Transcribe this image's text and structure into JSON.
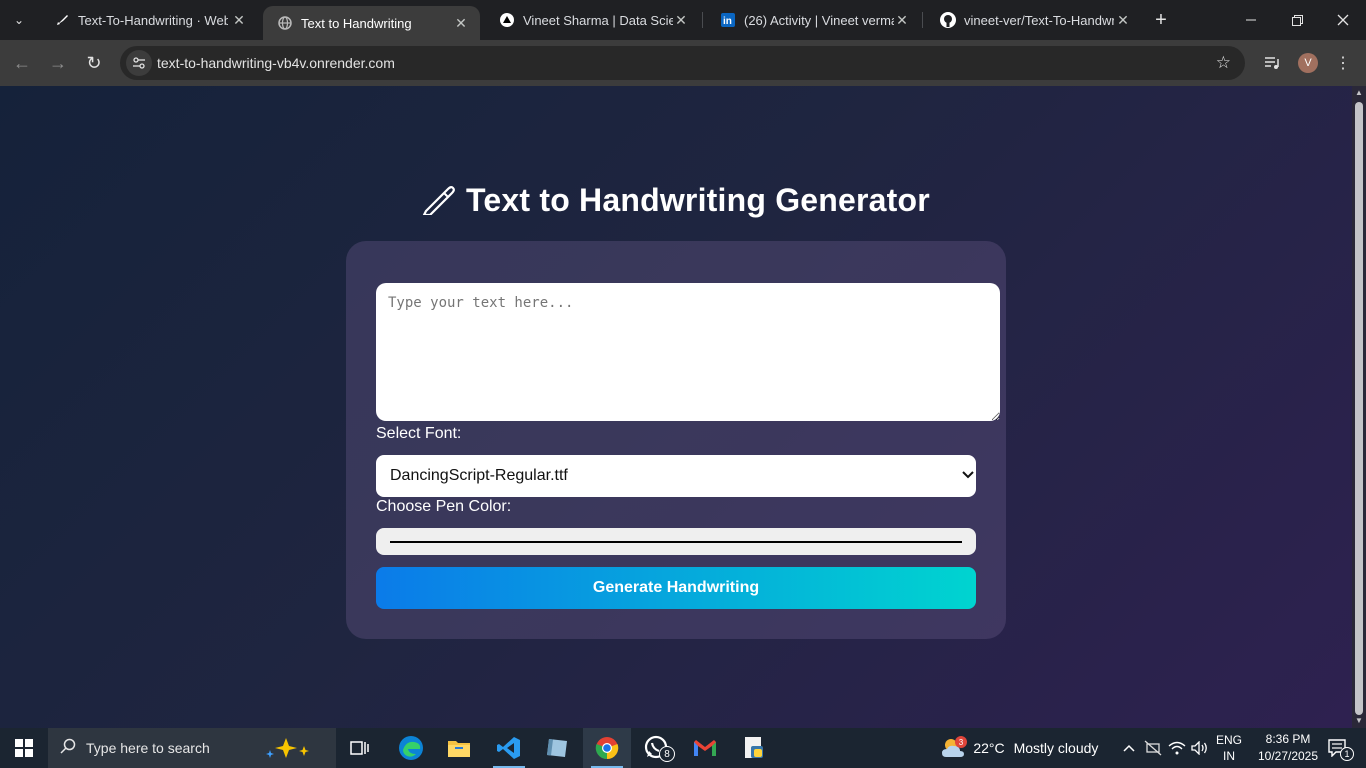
{
  "browser": {
    "tabs": [
      {
        "label": "Text-To-Handwriting · Web S",
        "icon": "pen-nib-icon"
      },
      {
        "label": "Text to Handwriting",
        "icon": "globe-icon"
      },
      {
        "label": "Vineet Sharma | Data Scienti",
        "icon": "triangle-logo-icon"
      },
      {
        "label": "(26) Activity | Vineet verma |",
        "icon": "linkedin-icon"
      },
      {
        "label": "vineet-ver/Text-To-Handwrit",
        "icon": "github-icon"
      }
    ],
    "active_tab": 1,
    "url": "text-to-handwriting-vb4v.onrender.com",
    "profile_initial": "V"
  },
  "page": {
    "title": "Text to Handwriting Generator",
    "textarea_placeholder": "Type your text here...",
    "font_label": "Select Font:",
    "font_selected": "DancingScript-Regular.ttf",
    "color_label": "Choose Pen Color:",
    "pen_color": "#000000",
    "generate_label": "Generate Handwriting"
  },
  "taskbar": {
    "search_placeholder": "Type here to search",
    "whatsapp_badge": "8",
    "weather_badge": "3",
    "weather_temp": "22°C",
    "weather_desc": "Mostly cloudy",
    "lang_top": "ENG",
    "lang_bottom": "IN",
    "time": "8:36 PM",
    "date": "10/27/2025",
    "notif_count": "1"
  },
  "colors": {
    "accent_start": "#0b7be9",
    "accent_end": "#00d4d0"
  }
}
